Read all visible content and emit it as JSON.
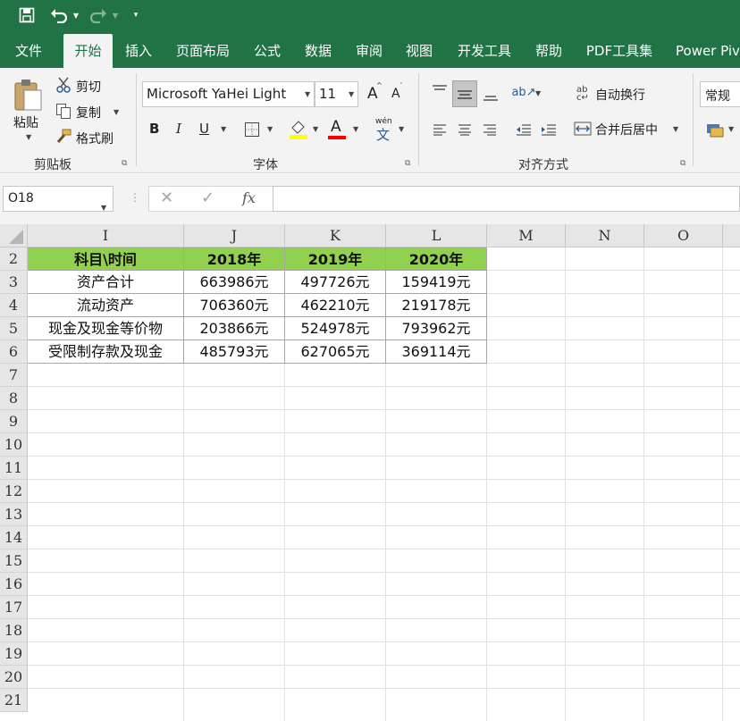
{
  "qat": {
    "save_icon": "save-icon",
    "undo_icon": "undo-icon",
    "redo_icon": "redo-icon",
    "customize_icon": "customize-qat-icon"
  },
  "tabs": [
    {
      "label": "文件"
    },
    {
      "label": "开始"
    },
    {
      "label": "插入"
    },
    {
      "label": "页面布局"
    },
    {
      "label": "公式"
    },
    {
      "label": "数据"
    },
    {
      "label": "审阅"
    },
    {
      "label": "视图"
    },
    {
      "label": "开发工具"
    },
    {
      "label": "帮助"
    },
    {
      "label": "PDF工具集"
    },
    {
      "label": "Power Piv"
    }
  ],
  "active_tab": "开始",
  "clipboard": {
    "paste": "粘贴",
    "cut": "剪切",
    "copy": "复制",
    "format_painter": "格式刷",
    "group": "剪贴板"
  },
  "font": {
    "name": "Microsoft YaHei Light",
    "size": "11",
    "grow": "A",
    "shrink": "A",
    "bold": "B",
    "italic": "I",
    "underline": "U",
    "font_color_glyph": "A",
    "phonetic": "wén",
    "group": "字体"
  },
  "alignment": {
    "wrap": "自动换行",
    "merge": "合并后居中",
    "group": "对齐方式"
  },
  "number": {
    "format": "常规"
  },
  "formula_bar": {
    "name_box": "O18",
    "fx": "fx",
    "content": ""
  },
  "colors": {
    "accent": "#217346",
    "header_fill": "#92d050",
    "fill_swatch": "#ffff00",
    "font_swatch": "#ff0000"
  },
  "columns": [
    "I",
    "J",
    "K",
    "L",
    "M",
    "N",
    "O"
  ],
  "rows": [
    "2",
    "3",
    "4",
    "5",
    "6",
    "7",
    "8",
    "9",
    "10",
    "11",
    "12",
    "13",
    "14",
    "15",
    "16",
    "17",
    "18",
    "19",
    "20",
    "21"
  ],
  "table": {
    "header": [
      "科目\\时间",
      "2018年",
      "2019年",
      "2020年"
    ],
    "body": [
      [
        "资产合计",
        "663986元",
        "497726元",
        "159419元"
      ],
      [
        "流动资产",
        "706360元",
        "462210元",
        "219178元"
      ],
      [
        "现金及现金等价物",
        "203866元",
        "524978元",
        "793962元"
      ],
      [
        "受限制存款及现金",
        "485793元",
        "627065元",
        "369114元"
      ]
    ]
  }
}
